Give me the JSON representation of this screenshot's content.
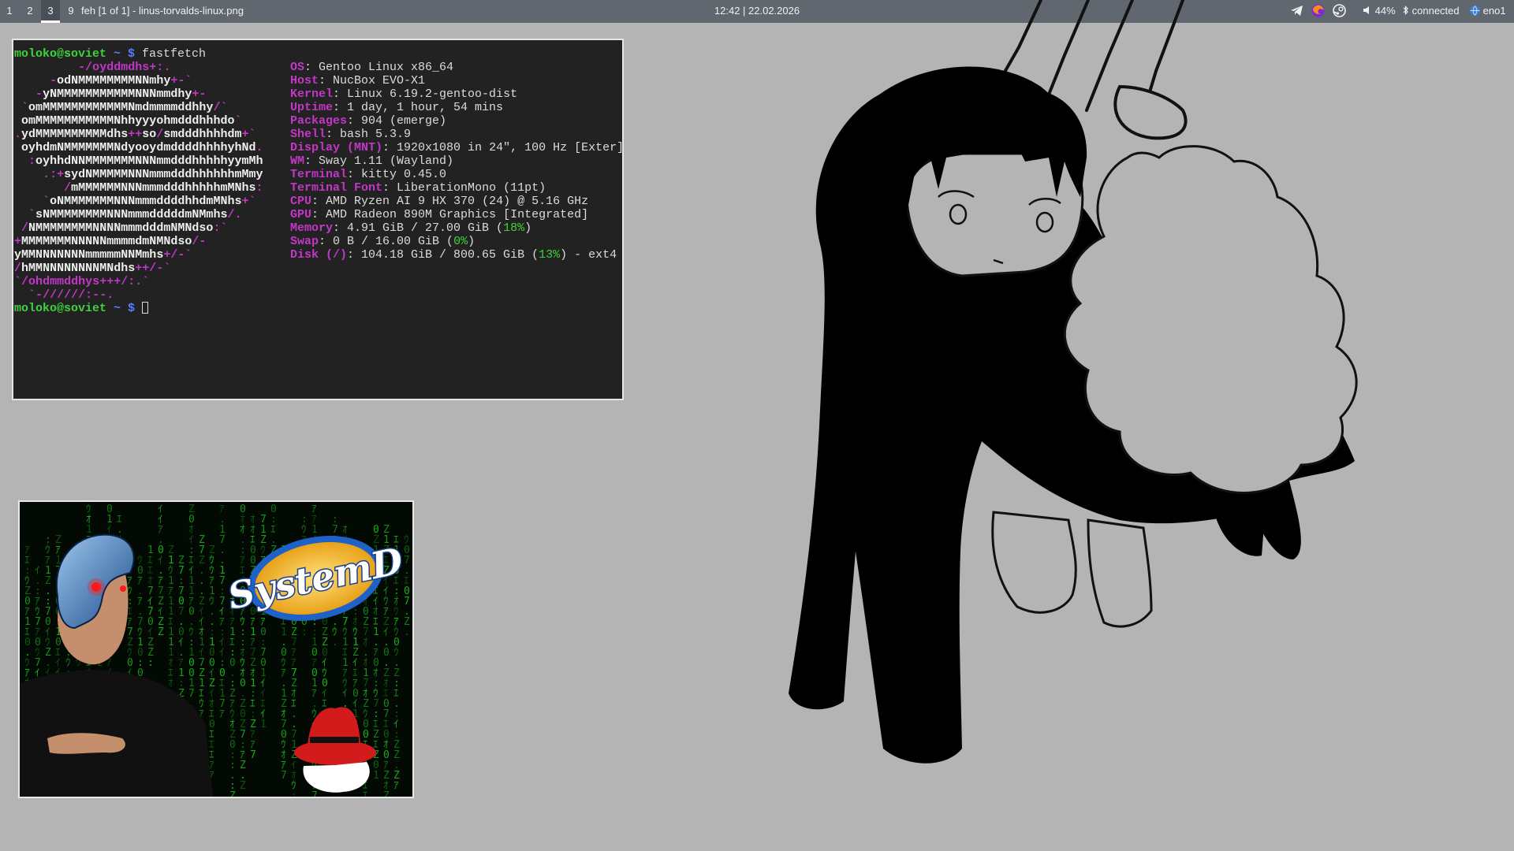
{
  "bar": {
    "workspaces": [
      {
        "label": "1",
        "active": false
      },
      {
        "label": "2",
        "active": false
      },
      {
        "label": "3",
        "active": true
      },
      {
        "label": "9",
        "active": false
      }
    ],
    "window_title": "feh [1 of 1] - linus-torvalds-linux.png",
    "clock": "12:42 | 22.02.2026",
    "tray_icons": [
      "telegram-icon",
      "firefox-icon",
      "steam-icon"
    ],
    "volume": "44%",
    "bluetooth": "connected",
    "network": "eno1",
    "colors": {
      "bar_bg": "#61676e",
      "active_ws": "#4a5057",
      "text": "#f2f2f2"
    }
  },
  "terminal": {
    "prompt_user": "moloko@soviet",
    "prompt_tail": " ~ $ ",
    "command": "fastfetch",
    "logo_lines": [
      "         -/oyddmdhs+:.",
      "     -odNMMMMMMMMNNmhy+-`",
      "   -yNMMMMMMMMMMMNNNmmdhy+-",
      " `omMMMMMMMMMMMMNmdmmmmddhhy/`",
      " omMMMMMMMMMMMNhhyyyohmdddhhhdo`",
      ".ydMMMMMMMMMMdhs++so/smdddhhhhdm+`",
      " oyhdmNMMMMMMMNdyooydmddddhhhhyhNd.",
      "  :oyhhdNNMMMMMMMNNNmmdddhhhhhyymMh",
      "    .:+sydNMMMMMNNNmmmdddhhhhhhmMmy",
      "       /mMMMMMMNNNmmmdddhhhhhmMNhs:",
      "    `oNMMMMMMMNNNmmmddddhhdmMNhs+`",
      "  `sNMMMMMMMMNNNmmmdddddmNMmhs/.",
      " /NMMMMMMMMNNNNmmmdddmNMNdso:`",
      "+MMMMMMMNNNNNmmmmdmNMNdso/-",
      "yMMNNNNNNNmmmmmNNMmhs+/-`",
      "/hMMNNNNNNNNMNdhs++/-`",
      "`/ohdmmddhys+++/:.`",
      "  `-//////:--."
    ],
    "info": [
      {
        "key": "OS",
        "value": "Gentoo Linux x86_64"
      },
      {
        "key": "Host",
        "value": "NucBox EVO-X1"
      },
      {
        "key": "Kernel",
        "value": "Linux 6.19.2-gentoo-dist"
      },
      {
        "key": "Uptime",
        "value": "1 day, 1 hour, 54 mins"
      },
      {
        "key": "Packages",
        "value": "904 (emerge)"
      },
      {
        "key": "Shell",
        "value": "bash 5.3.9"
      },
      {
        "key": "Display (MNT)",
        "value": "1920x1080 in 24\", 100 Hz [Exter]"
      },
      {
        "key": "WM",
        "value": "Sway 1.11 (Wayland)"
      },
      {
        "key": "Terminal",
        "value": "kitty 0.45.0"
      },
      {
        "key": "Terminal Font",
        "value": "LiberationMono (11pt)"
      },
      {
        "key": "CPU",
        "value": "AMD Ryzen AI 9 HX 370 (24) @ 5.16 GHz"
      },
      {
        "key": "GPU",
        "value": "AMD Radeon 890M Graphics [Integrated]"
      },
      {
        "key": "Memory",
        "value": "4.91 GiB / 27.00 GiB (",
        "pct": "18%",
        "tail": ")"
      },
      {
        "key": "Swap",
        "value": "0 B / 16.00 GiB (",
        "pct": "0%",
        "tail": ")"
      },
      {
        "key": "Disk (/)",
        "value": "104.18 GiB / 800.65 GiB (",
        "pct": "13%",
        "tail": ") - ext4"
      }
    ],
    "colors": {
      "bg": "#222222",
      "user": "#3fd23f",
      "dollar": "#5a7cff",
      "key": "#c337c8"
    }
  },
  "feh": {
    "logo_text": "SystemD"
  }
}
